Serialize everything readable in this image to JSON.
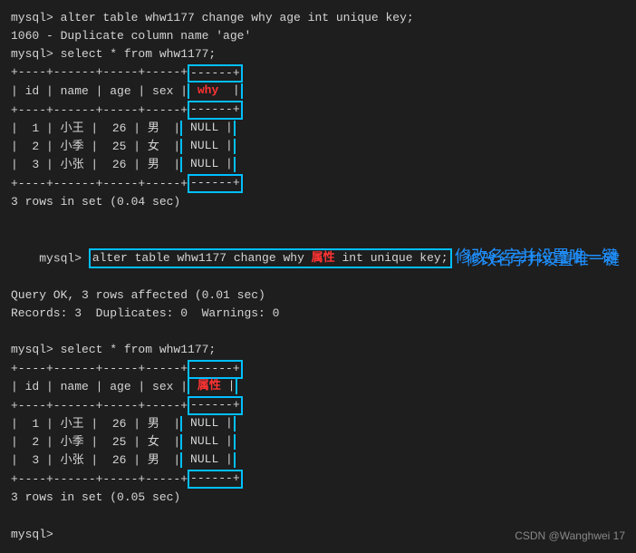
{
  "terminal": {
    "lines": [
      {
        "id": "l1",
        "type": "command",
        "text": "mysql> alter table whw1177 change why age int unique key;"
      },
      {
        "id": "l2",
        "type": "error",
        "text": "1060 - Duplicate column name 'age'"
      },
      {
        "id": "l3",
        "type": "command",
        "text": "mysql> select * from whw1177;"
      },
      {
        "id": "l4",
        "type": "table-sep",
        "text": "+----+------+-----+-----+------+"
      },
      {
        "id": "l5",
        "type": "table-header",
        "text": "| id | name | age | sex | why  |"
      },
      {
        "id": "l6",
        "type": "table-sep",
        "text": "+----+------+-----+-----+------+"
      },
      {
        "id": "l7",
        "type": "table-row",
        "text": "|  1 | 小王 |  26 | 男  | NULL |"
      },
      {
        "id": "l8",
        "type": "table-row",
        "text": "|  2 | 小季 |  25 | 女  | NULL |"
      },
      {
        "id": "l9",
        "type": "table-row",
        "text": "|  3 | 小张 |  26 | 男  | NULL |"
      },
      {
        "id": "l10",
        "type": "table-sep",
        "text": "+----+------+-----+-----+------+"
      },
      {
        "id": "l11",
        "type": "info",
        "text": "3 rows in set (0.04 sec)"
      },
      {
        "id": "l12",
        "type": "blank",
        "text": ""
      },
      {
        "id": "l13",
        "type": "command-highlight",
        "text": "mysql> alter table whw1177 change why 属性 int unique key;"
      },
      {
        "id": "l14",
        "type": "ok",
        "text": "Query OK, 3 rows affected (0.01 sec)"
      },
      {
        "id": "l15",
        "type": "info",
        "text": "Records: 3  Duplicates: 0  Warnings: 0"
      },
      {
        "id": "l16",
        "type": "blank",
        "text": ""
      },
      {
        "id": "l17",
        "type": "command",
        "text": "mysql> select * from whw1177;"
      },
      {
        "id": "l18",
        "type": "table-sep2",
        "text": "+----+------+-----+-----+------+"
      },
      {
        "id": "l19",
        "type": "table-header2",
        "text": "| id | name | age | sex | 属性 |"
      },
      {
        "id": "l20",
        "type": "table-sep2",
        "text": "+----+------+-----+-----+------+"
      },
      {
        "id": "l21",
        "type": "table-row2",
        "text": "|  1 | 小王 |  26 | 男  | NULL |"
      },
      {
        "id": "l22",
        "type": "table-row2",
        "text": "|  2 | 小季 |  25 | 女  | NULL |"
      },
      {
        "id": "l23",
        "type": "table-row2",
        "text": "|  3 | 小张 |  26 | 男  | NULL |"
      },
      {
        "id": "l24",
        "type": "table-sep2",
        "text": "+----+------+-----+-----+------+"
      },
      {
        "id": "l25",
        "type": "info",
        "text": "3 rows in set (0.05 sec)"
      },
      {
        "id": "l26",
        "type": "blank",
        "text": ""
      },
      {
        "id": "l27",
        "type": "prompt",
        "text": "mysql> "
      }
    ],
    "annotation": "修改名字并设置唯一键",
    "watermark": "CSDN @Wanghwei  17"
  }
}
